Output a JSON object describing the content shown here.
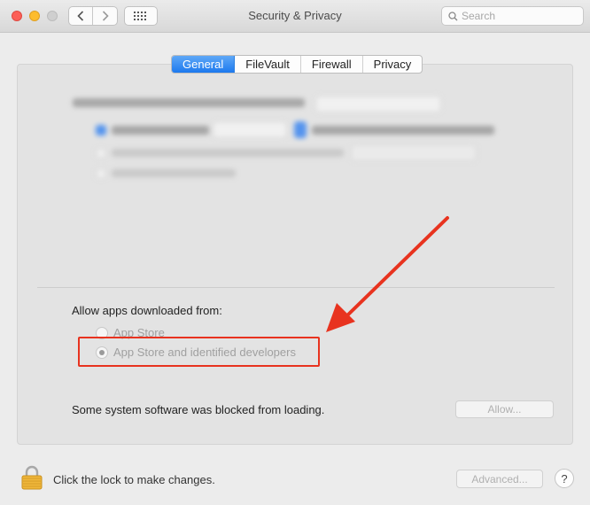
{
  "window": {
    "title": "Security & Privacy",
    "search_placeholder": "Search"
  },
  "tabs": [
    {
      "label": "General",
      "active": true
    },
    {
      "label": "FileVault",
      "active": false
    },
    {
      "label": "Firewall",
      "active": false
    },
    {
      "label": "Privacy",
      "active": false
    }
  ],
  "general": {
    "allow_apps_label": "Allow apps downloaded from:",
    "options": [
      {
        "label": "App Store",
        "selected": false
      },
      {
        "label": "App Store and identified developers",
        "selected": true
      }
    ],
    "blocked_text": "Some system software was blocked from loading.",
    "allow_button": "Allow..."
  },
  "footer": {
    "lock_text": "Click the lock to make changes.",
    "advanced_button": "Advanced...",
    "help_button": "?"
  },
  "colors": {
    "accent": "#1d79ee",
    "annotation": "#e8331f"
  }
}
